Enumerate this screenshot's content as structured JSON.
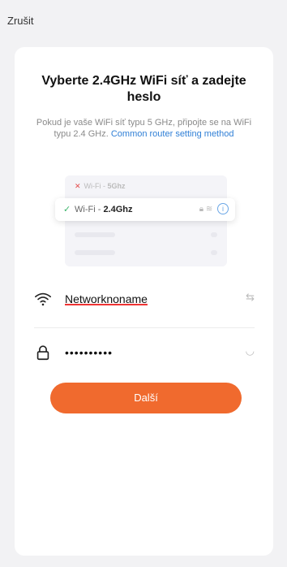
{
  "topbar": {
    "cancel_label": "Zrušit"
  },
  "heading": {
    "title": "Vyberte 2.4GHz WiFi síť a zadejte heslo"
  },
  "info": {
    "text": "Pokud je vaše WiFi síť typu 5 GHz, připojte se na WiFi typu 2.4 GHz.",
    "link_label": "Common router setting method"
  },
  "illustration": {
    "row_5ghz": {
      "prefix": "Wi-Fi - ",
      "band": "5Ghz"
    },
    "row_24ghz": {
      "prefix": "Wi-Fi - ",
      "band": "2.4Ghz"
    }
  },
  "form": {
    "network_name": "Networknoname",
    "password_masked": "••••••••••",
    "submit_label": "Další"
  },
  "colors": {
    "accent": "#f06a2e",
    "link": "#2f7fd6",
    "check": "#3bb56a",
    "error": "#e34b4b"
  }
}
